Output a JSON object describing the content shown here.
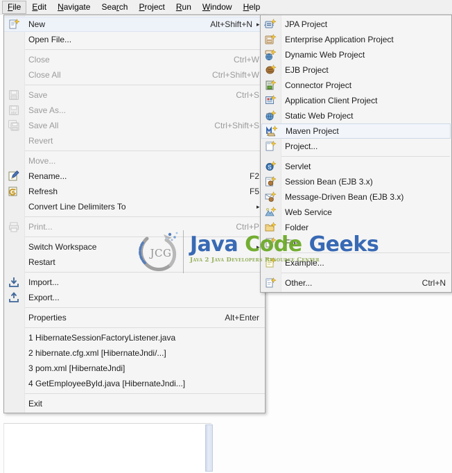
{
  "menubar": {
    "items": [
      {
        "label": "File",
        "mnemonic": "F",
        "active": true
      },
      {
        "label": "Edit",
        "mnemonic": "E",
        "active": false
      },
      {
        "label": "Navigate",
        "mnemonic": "N",
        "active": false
      },
      {
        "label": "Search",
        "mnemonic": "r",
        "active": false
      },
      {
        "label": "Project",
        "mnemonic": "P",
        "active": false
      },
      {
        "label": "Run",
        "mnemonic": "R",
        "active": false
      },
      {
        "label": "Window",
        "mnemonic": "W",
        "active": false
      },
      {
        "label": "Help",
        "mnemonic": "H",
        "active": false
      }
    ]
  },
  "file_menu": {
    "items": [
      {
        "label": "New",
        "accel": "Alt+Shift+N",
        "submenu": true,
        "selected": true,
        "icon": "new-file-icon"
      },
      {
        "label": "Open File...",
        "accel": "",
        "icon": ""
      },
      {
        "sep": true
      },
      {
        "label": "Close",
        "accel": "Ctrl+W",
        "disabled": true,
        "icon": ""
      },
      {
        "label": "Close All",
        "accel": "Ctrl+Shift+W",
        "disabled": true,
        "icon": ""
      },
      {
        "sep": true
      },
      {
        "label": "Save",
        "accel": "Ctrl+S",
        "disabled": true,
        "icon": "save-icon"
      },
      {
        "label": "Save As...",
        "accel": "",
        "disabled": true,
        "icon": "save-as-icon"
      },
      {
        "label": "Save All",
        "accel": "Ctrl+Shift+S",
        "disabled": true,
        "icon": "save-all-icon"
      },
      {
        "label": "Revert",
        "accel": "",
        "disabled": true,
        "icon": ""
      },
      {
        "sep": true
      },
      {
        "label": "Move...",
        "accel": "",
        "disabled": true,
        "icon": ""
      },
      {
        "label": "Rename...",
        "accel": "F2",
        "icon": "rename-pencil-icon"
      },
      {
        "label": "Refresh",
        "accel": "F5",
        "icon": "refresh-icon"
      },
      {
        "label": "Convert Line Delimiters To",
        "accel": "",
        "submenu": true,
        "icon": ""
      },
      {
        "sep": true
      },
      {
        "label": "Print...",
        "accel": "Ctrl+P",
        "disabled": true,
        "icon": "printer-icon"
      },
      {
        "sep": true
      },
      {
        "label": "Switch Workspace",
        "accel": "",
        "submenu": true,
        "icon": ""
      },
      {
        "label": "Restart",
        "accel": "",
        "icon": ""
      },
      {
        "sep": true
      },
      {
        "label": "Import...",
        "accel": "",
        "icon": "import-icon"
      },
      {
        "label": "Export...",
        "accel": "",
        "icon": "export-icon"
      },
      {
        "sep": true
      },
      {
        "label": "Properties",
        "accel": "Alt+Enter",
        "icon": ""
      },
      {
        "sep": true
      },
      {
        "label": "1 HibernateSessionFactoryListener.java",
        "accel": "",
        "icon": ""
      },
      {
        "label": "2 hibernate.cfg.xml  [HibernateJndi/...]",
        "accel": "",
        "icon": ""
      },
      {
        "label": "3 pom.xml  [HibernateJndi]",
        "accel": "",
        "icon": ""
      },
      {
        "label": "4 GetEmployeeById.java  [HibernateJndi...]",
        "accel": "",
        "icon": ""
      },
      {
        "sep": true
      },
      {
        "label": "Exit",
        "accel": "",
        "icon": ""
      }
    ]
  },
  "new_submenu": {
    "items": [
      {
        "label": "JPA Project",
        "accel": "",
        "icon": "jpa-project-icon"
      },
      {
        "label": "Enterprise Application Project",
        "accel": "",
        "icon": "enterprise-app-project-icon"
      },
      {
        "label": "Dynamic Web Project",
        "accel": "",
        "icon": "dynamic-web-project-icon"
      },
      {
        "label": "EJB Project",
        "accel": "",
        "icon": "ejb-project-icon"
      },
      {
        "label": "Connector Project",
        "accel": "",
        "icon": "connector-project-icon"
      },
      {
        "label": "Application Client Project",
        "accel": "",
        "icon": "app-client-project-icon"
      },
      {
        "label": "Static Web Project",
        "accel": "",
        "icon": "static-web-project-icon"
      },
      {
        "label": "Maven Project",
        "accel": "",
        "icon": "maven-project-icon",
        "selected": true
      },
      {
        "label": "Project...",
        "accel": "",
        "icon": "project-icon"
      },
      {
        "sep": true
      },
      {
        "label": "Servlet",
        "accel": "",
        "icon": "servlet-icon"
      },
      {
        "label": "Session Bean (EJB 3.x)",
        "accel": "",
        "icon": "session-bean-icon"
      },
      {
        "label": "Message-Driven Bean (EJB 3.x)",
        "accel": "",
        "icon": "message-driven-bean-icon"
      },
      {
        "label": "Web Service",
        "accel": "",
        "icon": "web-service-icon"
      },
      {
        "label": "Folder",
        "accel": "",
        "icon": "folder-icon"
      },
      {
        "label": "File",
        "accel": "",
        "icon": "file-icon"
      },
      {
        "sep": true
      },
      {
        "label": "Example...",
        "accel": "",
        "icon": "example-icon"
      },
      {
        "sep": true
      },
      {
        "label": "Other...",
        "accel": "Ctrl+N",
        "icon": "other-icon"
      }
    ]
  },
  "watermark": {
    "logo_text": "JCG",
    "title_part1": "Java ",
    "title_part2": "Code ",
    "title_part3": "Geeks",
    "tagline": "Java 2 Java Developers Resource Center",
    "color_blue": "#2a5fb0",
    "color_green": "#6aa925"
  },
  "colors": {
    "menu_background": "#f5f5f5",
    "menu_border": "#a5a5a5",
    "selection": "#eef2f9",
    "disabled_text": "#9b9b9b",
    "text": "#1c1c1c",
    "menubar_background": "#f0f0f0"
  }
}
